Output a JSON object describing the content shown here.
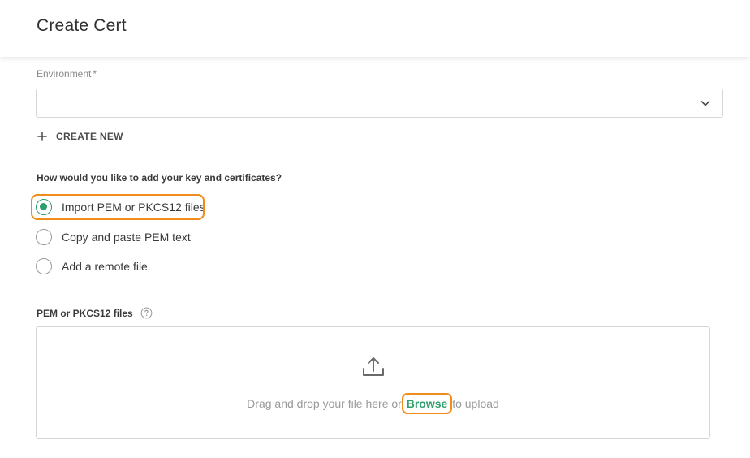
{
  "header": {
    "title": "Create Cert"
  },
  "environment": {
    "label": "Environment",
    "required_mark": "*",
    "value": "",
    "create_new_label": "CREATE NEW"
  },
  "import_method": {
    "question": "How would you like to add your key and certificates?",
    "options": [
      {
        "label": "Import PEM or PKCS12 files",
        "selected": true
      },
      {
        "label": "Copy and paste PEM text",
        "selected": false
      },
      {
        "label": "Add a remote file",
        "selected": false
      }
    ]
  },
  "files": {
    "label": "PEM or PKCS12 files",
    "drop_text_before": "Drag and drop your file here or ",
    "browse_label": "Browse",
    "drop_text_after": " to upload"
  },
  "colors": {
    "accent": "#2e9e6b",
    "highlight": "#f08c1a"
  }
}
